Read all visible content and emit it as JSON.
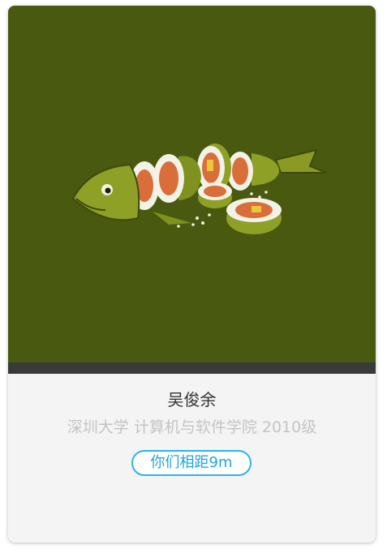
{
  "profile": {
    "photo_icon": "fish-sushi-illustration",
    "name": "吴俊余",
    "school": "深圳大学 计算机与软件学院 2010级",
    "distance_label": "你们相距9m"
  },
  "colors": {
    "photo_background": "#4a5910",
    "accent": "#2ab4e8",
    "secondary_text": "#c4c4c4"
  }
}
